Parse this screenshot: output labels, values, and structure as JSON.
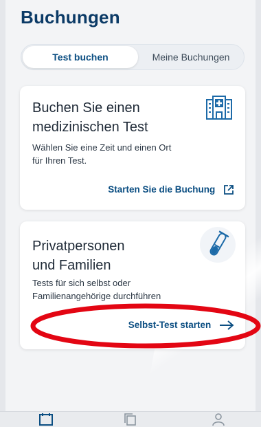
{
  "header": {
    "title": "Buchungen"
  },
  "tabs": [
    {
      "label": "Test buchen",
      "active": true
    },
    {
      "label": "Meine Buchungen",
      "active": false
    }
  ],
  "cards": [
    {
      "title_line1": "Buchen Sie einen",
      "title_line2": "medizinischen Test",
      "desc_line1": "Wählen Sie eine Zeit und einen Ort",
      "desc_line2": "für Ihren Test.",
      "action": "Starten Sie die Buchung",
      "icon": "hospital-icon",
      "action_icon": "external-link-icon"
    },
    {
      "title_line1": "Privatpersonen",
      "title_line2": "und Familien",
      "desc_line1": "Tests für sich selbst oder",
      "desc_line2": "Familienangehörige durchführen",
      "action": "Selbst-Test starten",
      "icon": "test-tube-icon",
      "action_icon": "arrow-right-icon"
    }
  ],
  "annotation": {
    "color": "#e30613",
    "shape": "ellipse"
  },
  "bottom_nav": {
    "items": [
      "calendar-icon",
      "copy-icon",
      "profile-icon"
    ]
  },
  "colors": {
    "primary": "#0b4e82",
    "title": "#0b3a66"
  }
}
